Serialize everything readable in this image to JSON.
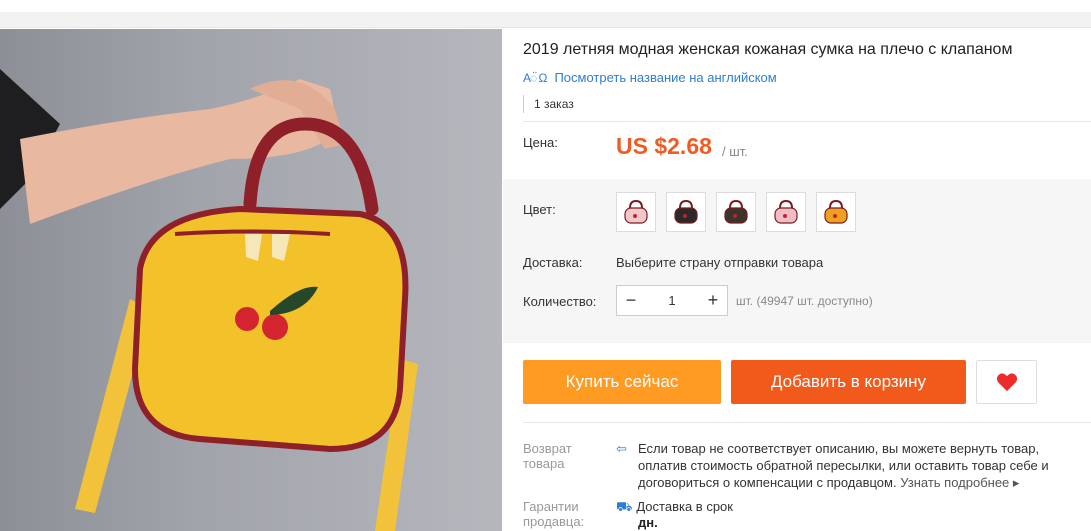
{
  "product": {
    "title": "2019 летняя модная женская кожаная сумка на плечо с клапаном",
    "translate_link": "Посмотреть название на английском",
    "orders": "1 заказ"
  },
  "price": {
    "label": "Цена:",
    "value": "US $2.68",
    "unit": "/ шт."
  },
  "color": {
    "label": "Цвет:",
    "swatches": [
      "#f0c8c8",
      "#2a2a2a",
      "#3a342c",
      "#f1bcc6",
      "#f0a020"
    ]
  },
  "shipping": {
    "label": "Доставка:",
    "value": "Выберите страну отправки товара"
  },
  "quantity": {
    "label": "Количество:",
    "value": "1",
    "note": "шт. (49947 шт. доступно)"
  },
  "buttons": {
    "buy_now": "Купить сейчас",
    "add_to_cart": "Добавить в корзину"
  },
  "returns": {
    "label": "Возврат товара",
    "text": "Если товар не соответствует описанию, вы можете вернуть товар, оплатив стоимость обратной пересылки, или оставить товар себе и договориться о компенсации с продавцом.",
    "more": "Узнать подробнее ▸"
  },
  "guarantee": {
    "label": "Гарантии продавца:",
    "text": "Доставка в срок",
    "sub": "дн."
  },
  "colors": {
    "price": "#f05b25",
    "buy_button": "#ff9a22",
    "cart_button": "#f25a1c",
    "link": "#2e7cd6",
    "heart": "#ee2b2b"
  }
}
